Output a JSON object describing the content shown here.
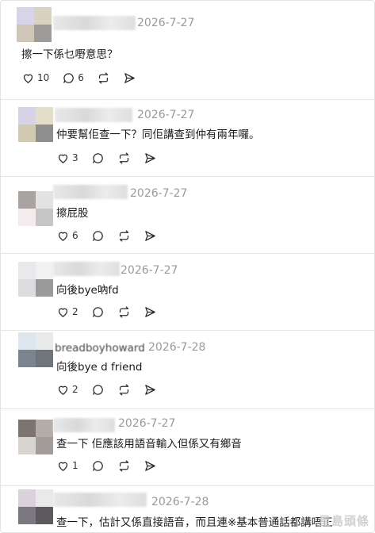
{
  "posts": [
    {
      "date": "2026-7-27",
      "text": "擦一下係乜嘢意思？",
      "likes": "10",
      "replies": "6"
    },
    {
      "date": "2026-7-27",
      "text": "仲要幫佢查一下？同佢講查到仲有兩年囉。",
      "likes": "3",
      "replies": ""
    },
    {
      "date": "2026-7-27",
      "text": "擦屁股",
      "likes": "6",
      "replies": ""
    },
    {
      "date": "2026-7-27",
      "text": "向後bye吶fd",
      "likes": "2",
      "replies": ""
    },
    {
      "username": "breadboyhoward",
      "date": "2026-7-28",
      "text": "向後bye d friend",
      "likes": "2",
      "replies": ""
    },
    {
      "date": "2026-7-27",
      "text": "查一下 佢應該用語音輸入但係又有鄉音",
      "likes": "1",
      "replies": ""
    },
    {
      "date": "2026-7-28",
      "text": "查一下，估計又係直接語音，而且連※基本普通話都講唔正",
      "likes": "",
      "replies": ""
    }
  ],
  "watermark": "星島頭條",
  "icons": [
    "heart-icon",
    "reply-icon",
    "repost-icon",
    "share-icon"
  ]
}
